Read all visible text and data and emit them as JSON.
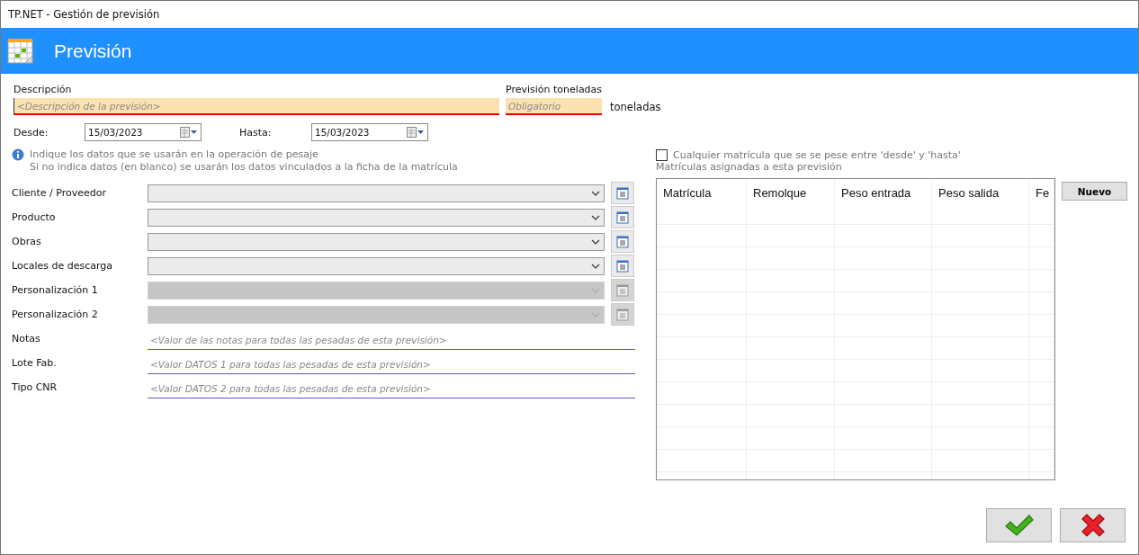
{
  "window": {
    "title": "TP.NET - Gestión de previsión"
  },
  "header": {
    "title": "Previsión"
  },
  "descripcion": {
    "label": "Descripción",
    "placeholder": "<Descripción de la previsión>"
  },
  "toneladas": {
    "label": "Previsión toneladas",
    "placeholder": "Obligatorio",
    "unit": "toneladas"
  },
  "desde": {
    "label": "Desde:",
    "value": "15/03/2023"
  },
  "hasta": {
    "label": "Hasta:",
    "value": "15/03/2023"
  },
  "info": [
    "Indique los datos que se usarán en la operación de pesaje",
    "Si no indica datos (en blanco) se usarán los datos vinculados a la ficha de la matrícula"
  ],
  "fields": [
    {
      "kind": "combo",
      "label": "Cliente / Proveedor",
      "disabled": false
    },
    {
      "kind": "combo",
      "label": "Producto",
      "disabled": false
    },
    {
      "kind": "combo",
      "label": "Obras",
      "disabled": false
    },
    {
      "kind": "combo",
      "label": "Locales de descarga",
      "disabled": false
    },
    {
      "kind": "combo",
      "label": "Personalización 1",
      "disabled": true
    },
    {
      "kind": "combo",
      "label": "Personalización 2",
      "disabled": true
    },
    {
      "kind": "text",
      "label": "Notas",
      "placeholder": "<Valor de las notas para todas las pesadas de esta previsión>"
    },
    {
      "kind": "text",
      "label": "Lote Fab.",
      "placeholder": "<Valor DATOS 1 para todas las pesadas de esta previsión>"
    },
    {
      "kind": "text",
      "label": "Tipo CNR",
      "placeholder": "<Valor DATOS 2 para todas las pesadas de esta previsión>"
    }
  ],
  "any_plate": {
    "label": "Cualquier matrícula que se se pese entre 'desde' y 'hasta'",
    "checked": false
  },
  "plates": {
    "label": "Matrículas asignadas a esta previsión",
    "columns": [
      "Matrícula",
      "Remolque",
      "Peso entrada",
      "Peso salida",
      "Fe"
    ],
    "new_button": "Nuevo"
  }
}
